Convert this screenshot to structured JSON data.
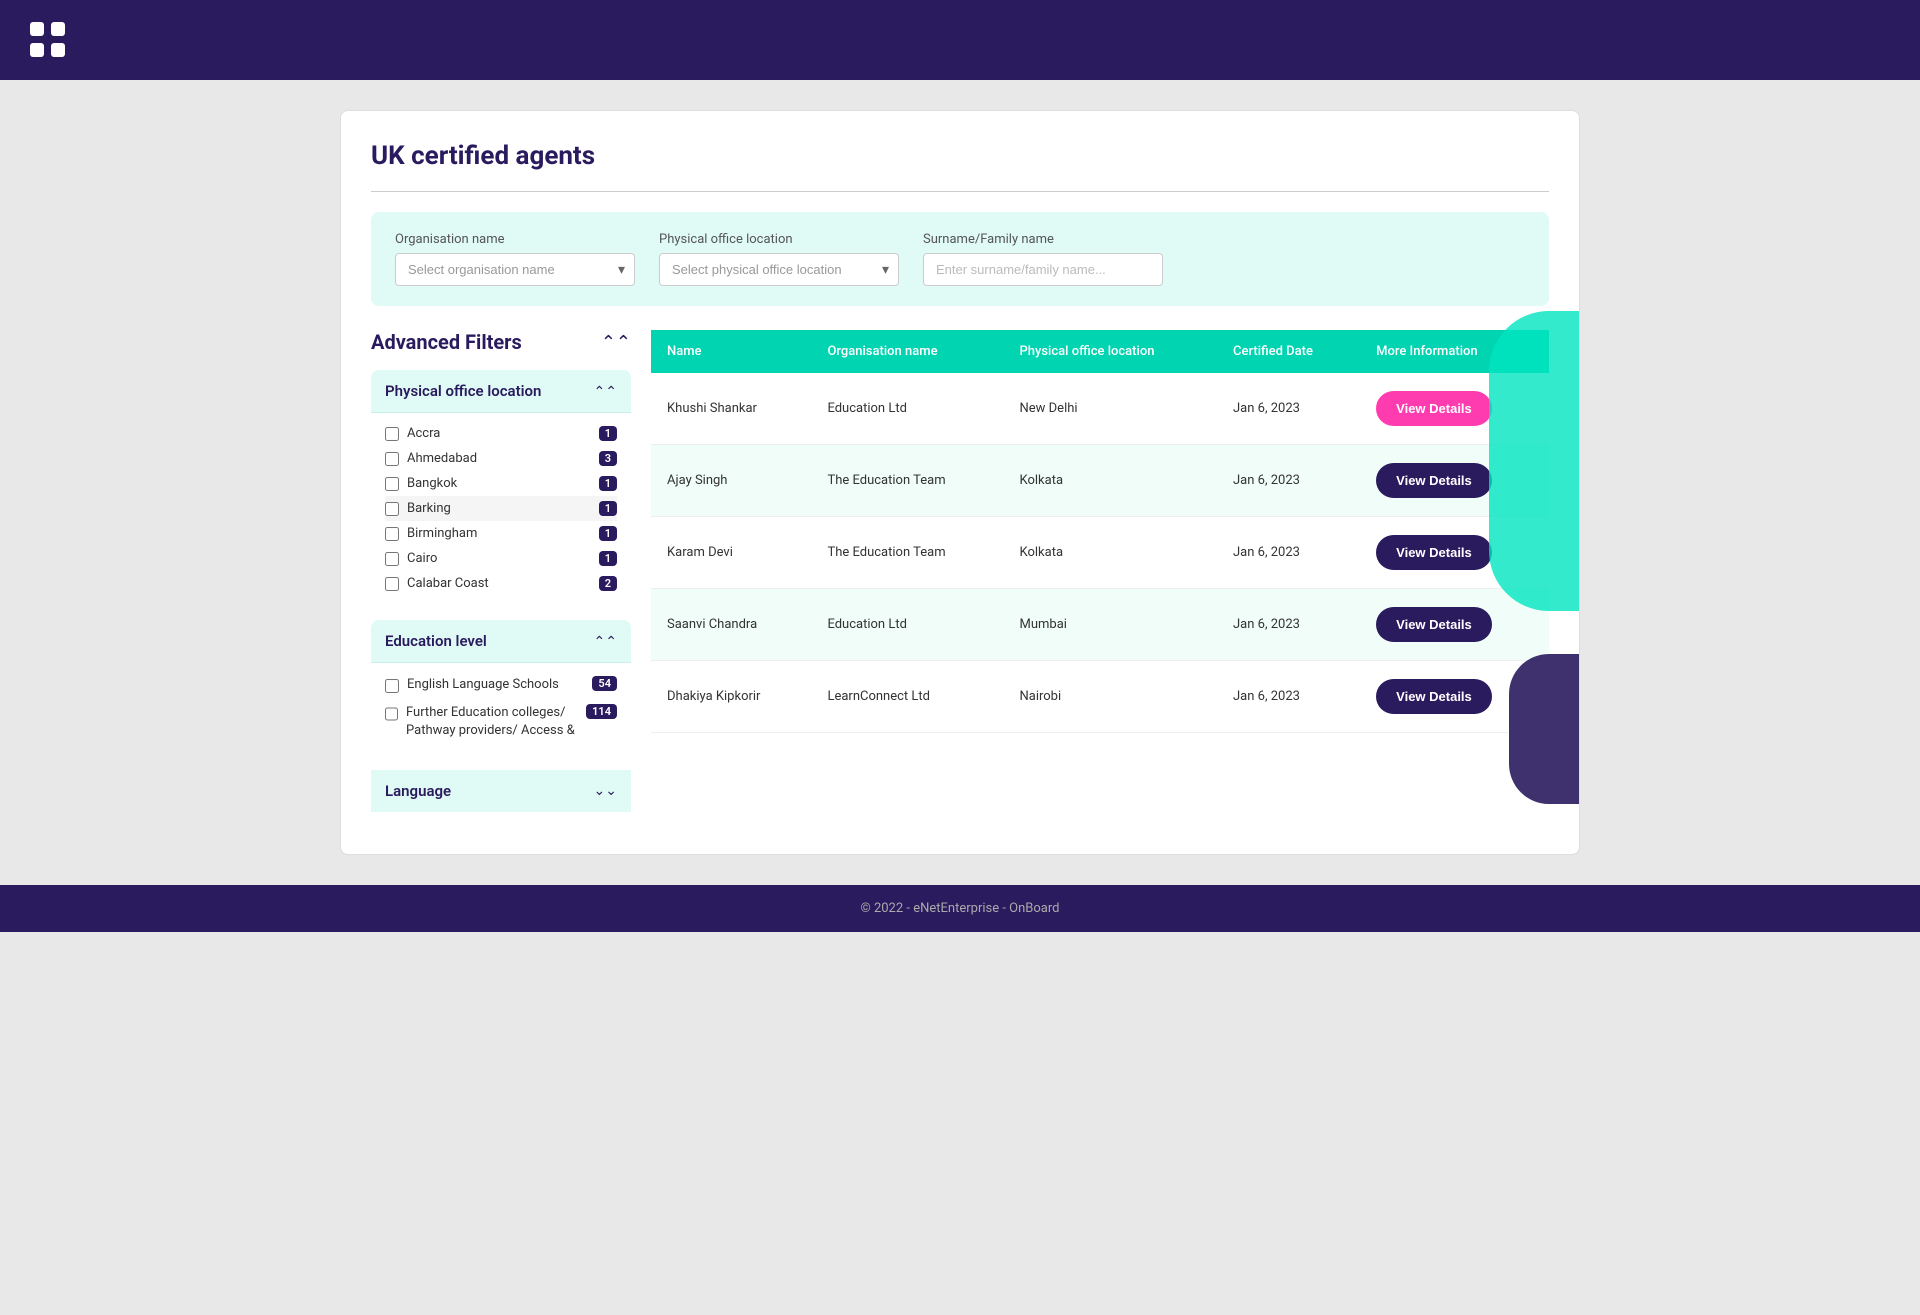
{
  "nav": {
    "logo_dots": [
      "dot1",
      "dot2",
      "dot3",
      "dot4"
    ]
  },
  "page": {
    "title": "UK certified agents",
    "divider": true
  },
  "filters": {
    "org_name_label": "Organisation name",
    "org_name_placeholder": "Select organisation name",
    "office_location_label": "Physical office location",
    "office_location_placeholder": "Select physical office location",
    "surname_label": "Surname/Family name",
    "surname_placeholder": "Enter surname/family name..."
  },
  "advanced_filters": {
    "title": "Advanced Filters",
    "sections": [
      {
        "id": "physical-office",
        "title": "Physical office location",
        "expanded": true,
        "items": [
          {
            "label": "Accra",
            "count": 1
          },
          {
            "label": "Ahmedabad",
            "count": 3
          },
          {
            "label": "Bangkok",
            "count": 1
          },
          {
            "label": "Barking",
            "count": 1
          },
          {
            "label": "Birmingham",
            "count": 1
          },
          {
            "label": "Cairo",
            "count": 1
          },
          {
            "label": "Calabar Coast",
            "count": 2
          }
        ]
      },
      {
        "id": "education-level",
        "title": "Education level",
        "expanded": true,
        "items": [
          {
            "label": "English Language Schools",
            "count": 54
          },
          {
            "label": "Further Education colleges/ Pathway providers/ Access &",
            "count": 114
          }
        ]
      },
      {
        "id": "language",
        "title": "Language",
        "expanded": false,
        "items": []
      }
    ]
  },
  "table": {
    "headers": [
      "Name",
      "Organisation name",
      "Physical office location",
      "Certified Date",
      "More Information"
    ],
    "rows": [
      {
        "name": "Khushi Shankar",
        "org": "Education Ltd",
        "location": "New Delhi",
        "date": "Jan 6, 2023",
        "btn_style": "pink",
        "btn_label": "View Details"
      },
      {
        "name": "Ajay Singh",
        "org": "The Education Team",
        "location": "Kolkata",
        "date": "Jan 6, 2023",
        "btn_style": "dark",
        "btn_label": "View Details"
      },
      {
        "name": "Karam Devi",
        "org": "The Education Team",
        "location": "Kolkata",
        "date": "Jan 6, 2023",
        "btn_style": "dark",
        "btn_label": "View Details"
      },
      {
        "name": "Saanvi Chandra",
        "org": "Education Ltd",
        "location": "Mumbai",
        "date": "Jan 6, 2023",
        "btn_style": "dark",
        "btn_label": "View Details"
      },
      {
        "name": "Dhakiya Kipkorir",
        "org": "LearnConnect Ltd",
        "location": "Nairobi",
        "date": "Jan 6, 2023",
        "btn_style": "dark",
        "btn_label": "View Details"
      }
    ]
  },
  "footer": {
    "text": "© 2022 - eNetEnterprise - OnBoard"
  }
}
